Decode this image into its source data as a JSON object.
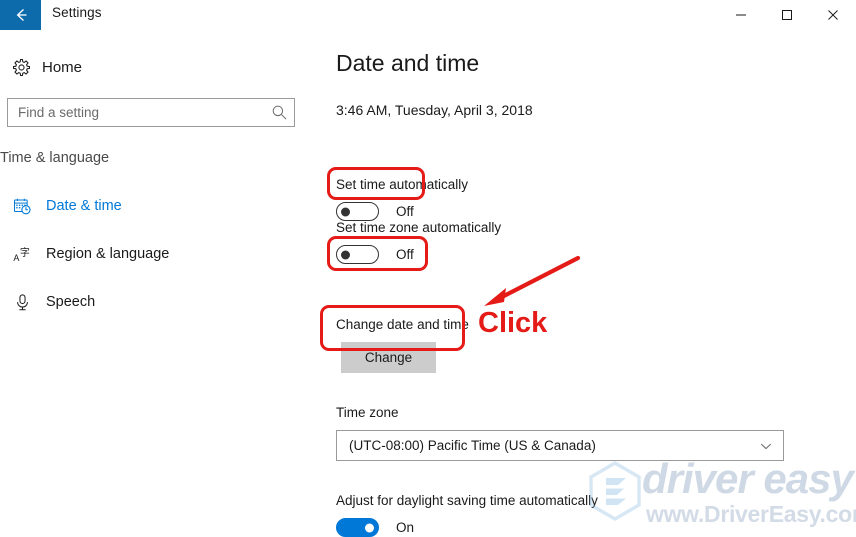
{
  "window": {
    "title": "Settings",
    "back_icon": "back-arrow-icon",
    "minimize_label": "—",
    "maximize_label": "□",
    "close_label": "✕",
    "accent_color": "#0d6aab"
  },
  "sidebar": {
    "home_label": "Home",
    "home_icon": "gear-icon",
    "search": {
      "placeholder": "Find a setting",
      "value": "",
      "icon": "search-icon"
    },
    "category_label": "Time & language",
    "items": [
      {
        "label": "Date & time",
        "icon": "calendar-clock-icon",
        "active": true
      },
      {
        "label": "Region & language",
        "icon": "language-icon",
        "active": false
      },
      {
        "label": "Speech",
        "icon": "microphone-icon",
        "active": false
      }
    ],
    "active_color": "#0078d7"
  },
  "main": {
    "page_title": "Date and time",
    "current_time": "3:46 AM, Tuesday, April 3, 2018",
    "set_time_automatically": {
      "label": "Set time automatically",
      "state": "Off"
    },
    "set_timezone_automatically": {
      "label": "Set time zone automatically",
      "state": "Off"
    },
    "change_date_and_time": {
      "label": "Change date and time",
      "button_label": "Change"
    },
    "time_zone": {
      "label": "Time zone",
      "value": "(UTC-08:00) Pacific Time (US & Canada)",
      "chevron_icon": "chevron-down-icon"
    },
    "daylight_saving": {
      "label": "Adjust for daylight saving time automatically",
      "state": "On"
    }
  },
  "annotations": {
    "click_label": "Click",
    "color": "#e41b17",
    "arrow_icon": "red-arrow-icon",
    "highlight_boxes": [
      "set-time-automatically-toggle",
      "set-timezone-automatically-toggle",
      "change-button"
    ]
  },
  "watermark": {
    "brand": "driver easy",
    "url": "www.DriverEasy.com",
    "logo_icon": "driver-easy-logo-icon"
  }
}
